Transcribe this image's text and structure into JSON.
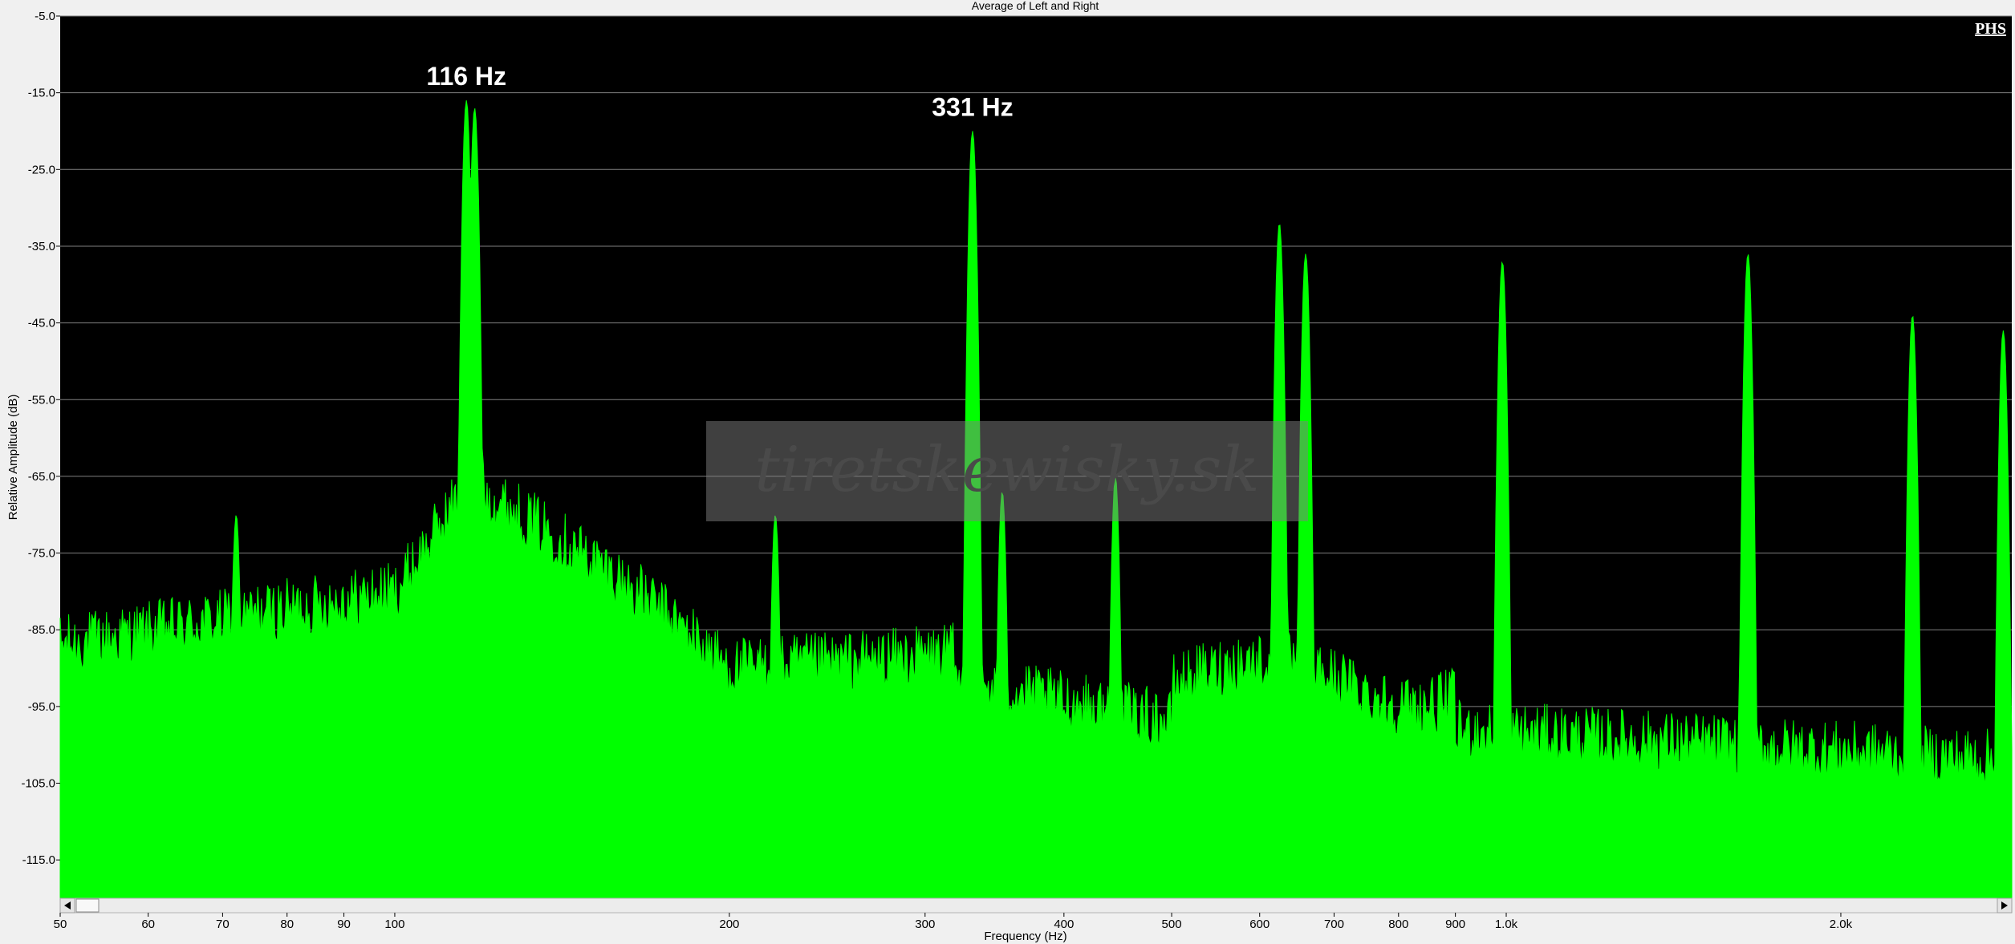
{
  "chart_data": {
    "type": "area",
    "title": "Average of Left and Right",
    "xlabel": "Frequency (Hz)",
    "ylabel": "Relative Amplitude (dB)",
    "x_scale": "log",
    "xlim": [
      50,
      2850
    ],
    "ylim": [
      -120,
      -5
    ],
    "x_ticks": [
      {
        "value": 50,
        "label": "50"
      },
      {
        "value": 60,
        "label": "60"
      },
      {
        "value": 70,
        "label": "70"
      },
      {
        "value": 80,
        "label": "80"
      },
      {
        "value": 90,
        "label": "90"
      },
      {
        "value": 100,
        "label": "100"
      },
      {
        "value": 200,
        "label": "200"
      },
      {
        "value": 300,
        "label": "300"
      },
      {
        "value": 400,
        "label": "400"
      },
      {
        "value": 500,
        "label": "500"
      },
      {
        "value": 600,
        "label": "600"
      },
      {
        "value": 700,
        "label": "700"
      },
      {
        "value": 800,
        "label": "800"
      },
      {
        "value": 900,
        "label": "900"
      },
      {
        "value": 1000,
        "label": "1.0k"
      },
      {
        "value": 2000,
        "label": "2.0k"
      }
    ],
    "y_ticks": [
      {
        "value": -5,
        "label": "-5.0"
      },
      {
        "value": -15,
        "label": "-15.0"
      },
      {
        "value": -25,
        "label": "-25.0"
      },
      {
        "value": -35,
        "label": "-35.0"
      },
      {
        "value": -45,
        "label": "-45.0"
      },
      {
        "value": -55,
        "label": "-55.0"
      },
      {
        "value": -65,
        "label": "-65.0"
      },
      {
        "value": -75,
        "label": "-75.0"
      },
      {
        "value": -85,
        "label": "-85.0"
      },
      {
        "value": -95,
        "label": "-95.0"
      },
      {
        "value": -105,
        "label": "-105.0"
      },
      {
        "value": -115,
        "label": "-115.0"
      }
    ],
    "grid": true,
    "series_color": "#00ff00",
    "peaks": [
      {
        "x": 116,
        "y": -16
      },
      {
        "x": 118,
        "y": -17
      },
      {
        "x": 331,
        "y": -20
      },
      {
        "x": 625,
        "y": -32
      },
      {
        "x": 660,
        "y": -36
      },
      {
        "x": 992,
        "y": -37
      },
      {
        "x": 1650,
        "y": -36
      },
      {
        "x": 2320,
        "y": -44
      },
      {
        "x": 2800,
        "y": -46
      },
      {
        "x": 445,
        "y": -65
      },
      {
        "x": 352,
        "y": -67
      },
      {
        "x": 220,
        "y": -70
      },
      {
        "x": 72,
        "y": -70
      }
    ],
    "annotations": [
      {
        "x": 116,
        "y": -14,
        "text": "116 Hz"
      },
      {
        "x": 331,
        "y": -18,
        "text": "331 Hz"
      }
    ]
  },
  "logo": "PHS",
  "watermark": "tiretskewisky.sk",
  "colors": {
    "plot_background": "#000000",
    "trace": "#00ff00",
    "grid": "#808080",
    "frame": "#f0f0f0"
  }
}
